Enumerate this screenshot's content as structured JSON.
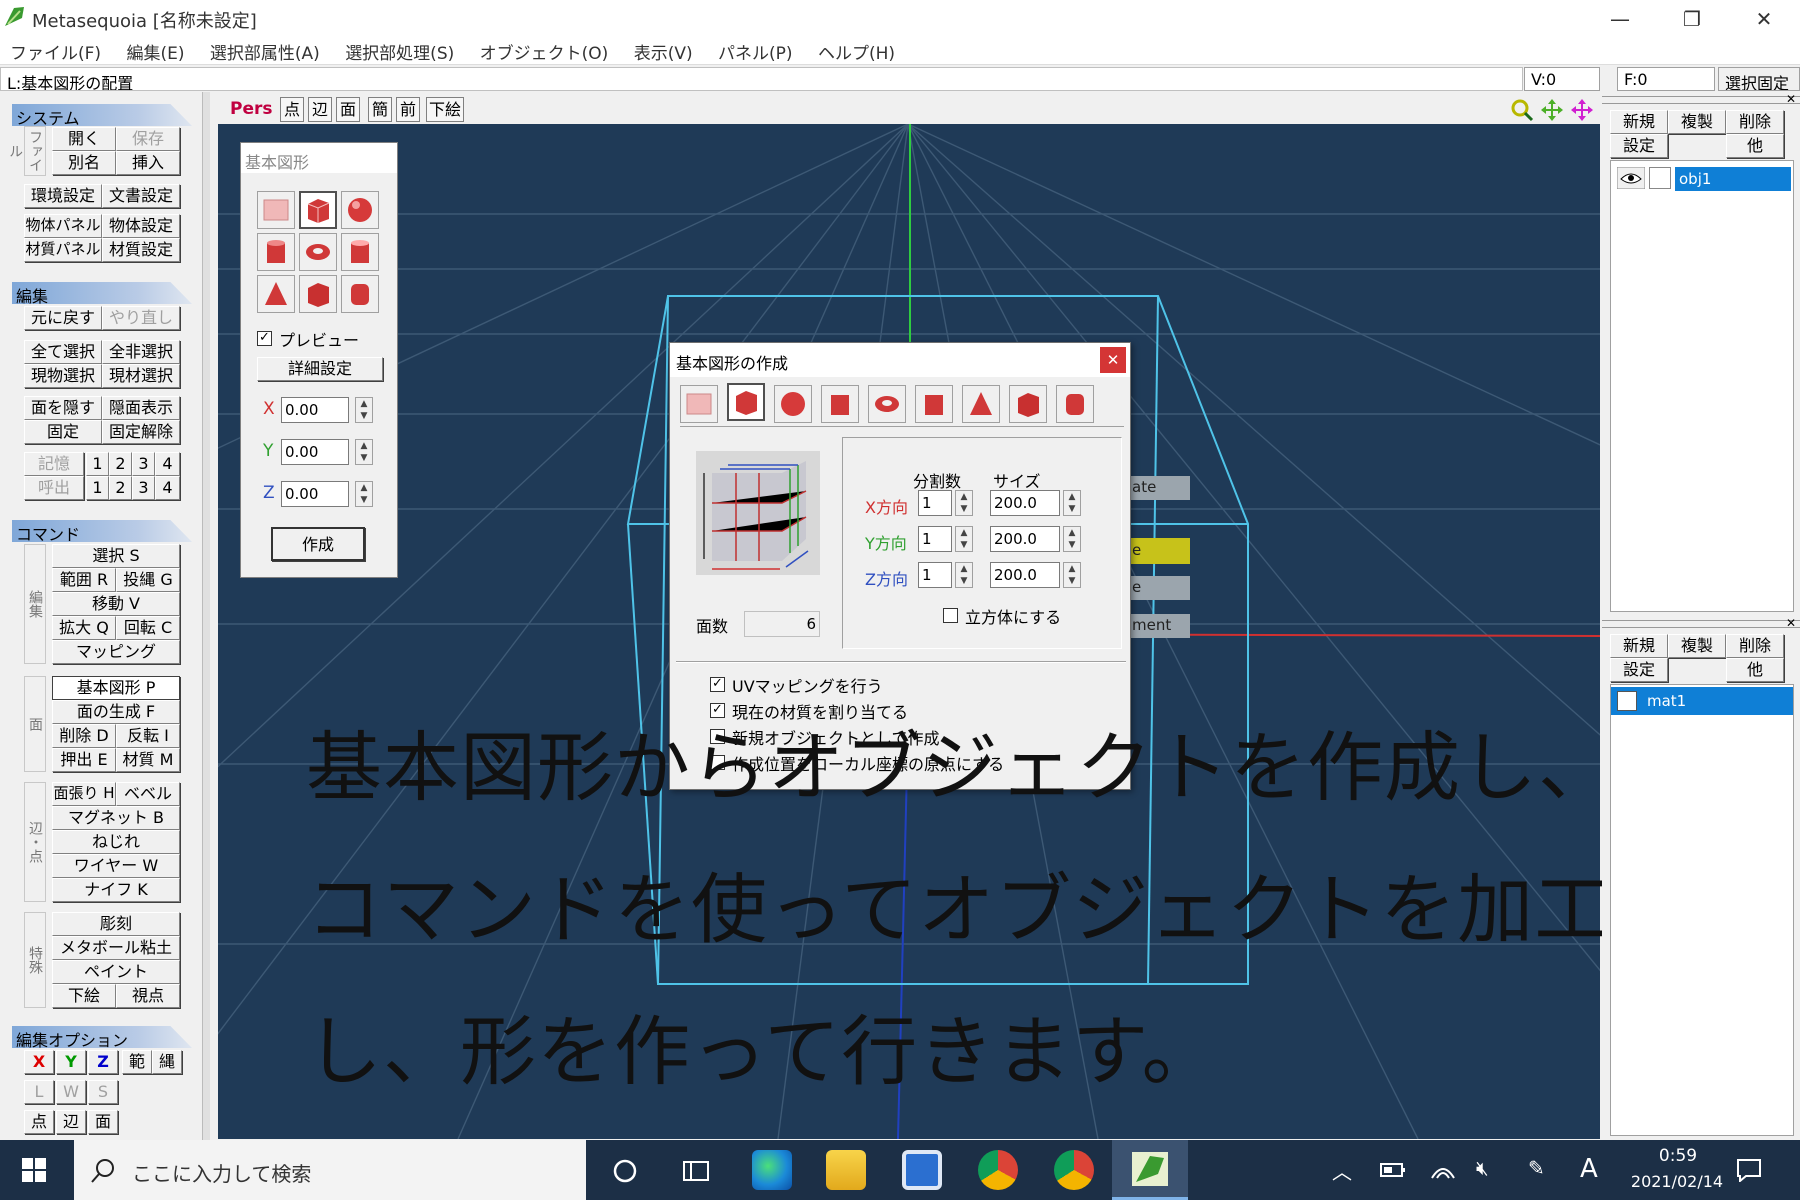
{
  "window": {
    "title": "Metasequoia [名称未設定]"
  },
  "menu": [
    "ファイル(F)",
    "編集(E)",
    "選択部属性(A)",
    "選択部処理(S)",
    "オブジェクト(O)",
    "表示(V)",
    "パネル(P)",
    "ヘルプ(H)"
  ],
  "status": {
    "mode": "L:基本図形の配置",
    "vertex": "V:0",
    "face": "F:0",
    "lock": "選択固定"
  },
  "left_panel": {
    "system": {
      "title": "システム",
      "file_label": "ファイル",
      "open": "開く",
      "save": "保存",
      "saveas": "別名",
      "insert": "挿入",
      "env": "環境設定",
      "doc": "文書設定",
      "objpanel": "物体パネル",
      "objset": "物体設定",
      "matpanel": "材質パネル",
      "matset": "材質設定"
    },
    "edit": {
      "title": "編集",
      "undo": "元に戻す",
      "redo": "やり直し",
      "selall": "全て選択",
      "selnone": "全非選択",
      "selobj": "現物選択",
      "selmat": "現材選択",
      "hide": "面を隠す",
      "show": "隠面表示",
      "fix": "固定",
      "unfix": "固定解除",
      "mem": "記憶",
      "recall": "呼出",
      "n1": "1",
      "n2": "2",
      "n3": "3",
      "n4": "4"
    },
    "command": {
      "title": "コマンド",
      "group1": "編集",
      "select": "選択 S",
      "range": "範囲 R",
      "lasso": "投縄 G",
      "move": "移動 V",
      "scale": "拡大 Q",
      "rotate": "回転 C",
      "mapping": "マッピング",
      "group2": "面",
      "primitive": "基本図形 P",
      "genface": "面の生成 F",
      "delete": "削除 D",
      "flip": "反転 I",
      "extrude": "押出 E",
      "material": "材質 M",
      "group3": "辺・点",
      "facestretch": "面張り H",
      "bevel": "ベベル",
      "magnet": "マグネット B",
      "twist": "ねじれ",
      "wire": "ワイヤー W",
      "knife": "ナイフ K",
      "group4": "特殊",
      "sculpt": "彫刻",
      "metaball": "メタボール粘土",
      "paint": "ペイント",
      "underlay": "下絵",
      "viewpoint": "視点"
    },
    "editopt": {
      "title": "編集オプション",
      "x": "X",
      "y": "Y",
      "z": "Z",
      "range": "範",
      "rope": "縄",
      "l": "L",
      "w": "W",
      "s": "S",
      "pt": "点",
      "edge": "辺",
      "face": "面"
    }
  },
  "viewport_toolbar": {
    "pers": "Pers",
    "pt": "点",
    "edge": "辺",
    "face": "面",
    "simple": "簡",
    "front": "前",
    "underlay": "下絵"
  },
  "primitive_palette": {
    "title": "基本図形",
    "preview": "プレビュー",
    "preview_checked": true,
    "detail": "詳細設定",
    "x_label": "X",
    "x": "0.00",
    "y_label": "Y",
    "y": "0.00",
    "z_label": "Z",
    "z": "0.00",
    "create": "作成"
  },
  "dialog": {
    "title": "基本図形の作成",
    "col_div": "分割数",
    "col_size": "サイズ",
    "rows": [
      {
        "label": "X方向",
        "div": "1",
        "size": "200.0",
        "color": "#d03030"
      },
      {
        "label": "Y方向",
        "div": "1",
        "size": "200.0",
        "color": "#30a030"
      },
      {
        "label": "Z方向",
        "div": "1",
        "size": "200.0",
        "color": "#3050c0"
      }
    ],
    "cube_label": "立方体にする",
    "cube_checked": false,
    "faces_label": "面数",
    "faces": "6",
    "opt_uv": "UVマッピングを行う",
    "opt_mat": "現在の材質を割り当てる",
    "opt_new": "新規オブジェクトとして作成",
    "opt_local": "作成位置をローカル座標の原点にする"
  },
  "hidden_dialog_labels": [
    "ate",
    "e",
    "e",
    "ment"
  ],
  "right_panel": {
    "obj": {
      "new": "新規",
      "dup": "複製",
      "del": "削除",
      "settings": "設定",
      "other": "他",
      "item": "obj1"
    },
    "mat": {
      "new": "新規",
      "dup": "複製",
      "del": "削除",
      "settings": "設定",
      "other": "他",
      "item": "mat1"
    }
  },
  "caption": {
    "line1": "基本図形からオブジェクトを作成し、",
    "line2": "コマンドを使ってオブジェクトを加工",
    "line3": "し、形を作って行きます。"
  },
  "taskbar": {
    "search": "ここに入力して検索",
    "time": "0:59",
    "date": "2021/02/14",
    "ime": "A"
  }
}
